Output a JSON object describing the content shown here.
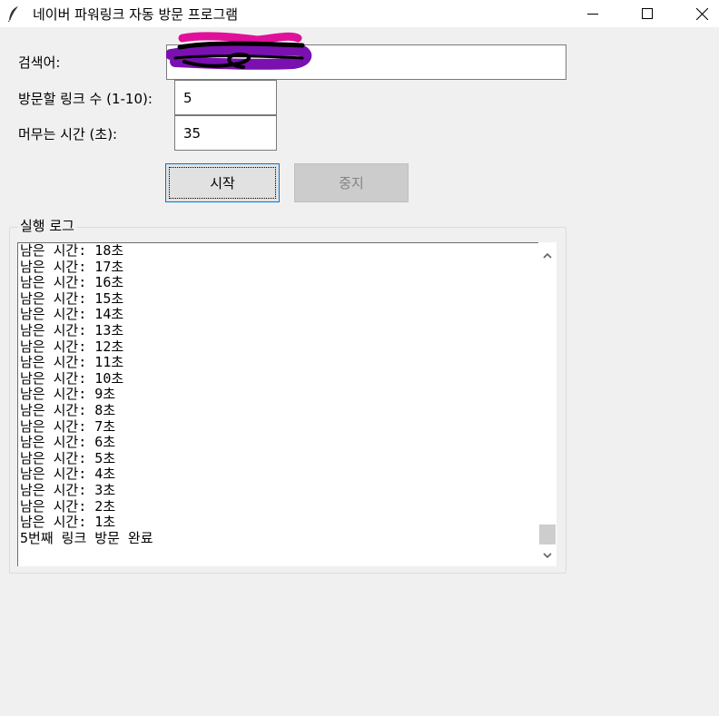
{
  "window": {
    "title": "네이버 파워링크 자동 방문 프로그램",
    "icon": "feather-icon",
    "controls": [
      "minimize-icon",
      "maximize-icon",
      "close-icon"
    ]
  },
  "form": {
    "keyword_label": "검색어:",
    "keyword_value": "",
    "link_count_label": "방문할 링크 수 (1-10):",
    "link_count_value": "5",
    "stay_time_label": "머무는 시간 (초):",
    "stay_time_value": "35"
  },
  "buttons": {
    "start_label": "시작",
    "stop_label": "중지",
    "stop_disabled": true
  },
  "log": {
    "title": "실행 로그",
    "lines": [
      "남은 시간: 18초",
      "남은 시간: 17초",
      "남은 시간: 16초",
      "남은 시간: 15초",
      "남은 시간: 14초",
      "남은 시간: 13초",
      "남은 시간: 12초",
      "남은 시간: 11초",
      "남은 시간: 10초",
      "남은 시간: 9초",
      "남은 시간: 8초",
      "남은 시간: 7초",
      "남은 시간: 6초",
      "남은 시간: 5초",
      "남은 시간: 4초",
      "남은 시간: 3초",
      "남은 시간: 2초",
      "남은 시간: 1초",
      "5번째 링크 방문 완료"
    ]
  },
  "colors": {
    "window_bg": "#f0f0f0",
    "focus_border": "#0078d7",
    "redaction_magenta": "#e0109a",
    "redaction_purple": "#7a10b0"
  }
}
